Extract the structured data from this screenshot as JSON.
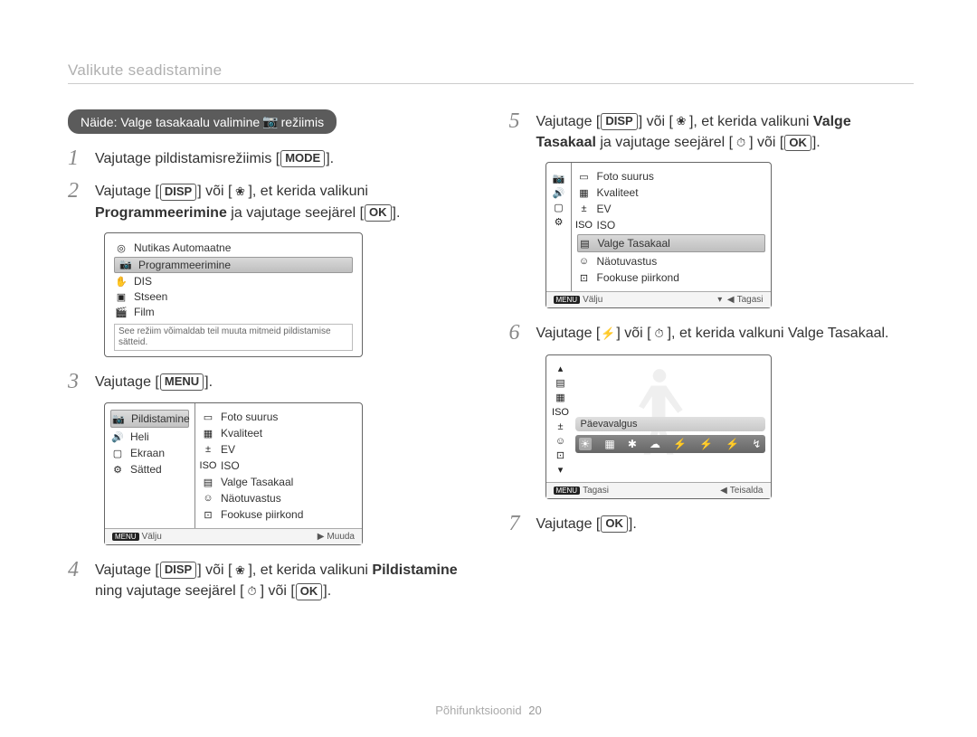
{
  "section_title": "Valikute seadistamine",
  "example_pill_prefix": "Näide: Valge tasakaalu valimine",
  "example_pill_icon": "camera-icon",
  "example_pill_suffix": "režiimis",
  "buttons": {
    "mode": "MODE",
    "disp": "DISP",
    "menu": "MENU",
    "ok": "OK"
  },
  "steps": {
    "1": {
      "text_before": "Vajutage pildistamisrežiimis [",
      "btn": "MODE",
      "text_after": "]."
    },
    "2": {
      "pre": "Vajutage [",
      "btn": "DISP",
      "mid1": "] või [",
      "icon": "macro-icon",
      "mid2": "], et kerida valikuni ",
      "bold1": "Programmeerimine",
      "mid3": " ja vajutage seejärel [",
      "ok": "OK",
      "after": "]."
    },
    "3": {
      "pre": "Vajutage [",
      "btn": "MENU",
      "after": "]."
    },
    "4": {
      "pre": "Vajutage [",
      "btn": "DISP",
      "mid1": "] või [",
      "icon1": "macro-icon",
      "mid2": "], et kerida valikuni ",
      "bold": "Pildistamine",
      "mid3": " ning vajutage seejärel [",
      "icon2": "timer-icon",
      "mid4": "] või [",
      "ok": "OK",
      "after": "]."
    },
    "5": {
      "pre": "Vajutage [",
      "btn": "DISP",
      "mid1": "] või [",
      "icon1": "macro-icon",
      "mid2": "], et kerida valikuni ",
      "bold1": "Valge Tasakaal",
      "mid3": " ja vajutage seejärel [",
      "icon2": "timer-icon",
      "mid4": "] või [",
      "ok": "OK",
      "after": "]."
    },
    "6": {
      "pre": "Vajutage [",
      "icon1": "flash-icon",
      "mid1": "] või [",
      "icon2": "timer-icon",
      "mid2": "], et kerida valkuni Valge Tasakaal."
    },
    "7": {
      "pre": "Vajutage [",
      "ok": "OK",
      "after": "]."
    }
  },
  "panel1": {
    "items": [
      {
        "icon": "smart-icon",
        "label": "Nutikas Automaatne"
      },
      {
        "icon": "camera-icon",
        "label": "Programmeerimine",
        "selected": true
      },
      {
        "icon": "dis-icon",
        "label": "DIS"
      },
      {
        "icon": "scene-icon",
        "label": "Stseen"
      },
      {
        "icon": "movie-icon",
        "label": "Film"
      }
    ],
    "hint": "See režiim võimaldab teil muuta mitmeid pildistamise sätteid."
  },
  "panel2": {
    "left": [
      {
        "icon": "camera-icon",
        "label": "Pildistamine",
        "selected": true
      },
      {
        "icon": "sound-icon",
        "label": "Heli"
      },
      {
        "icon": "display-icon",
        "label": "Ekraan"
      },
      {
        "icon": "gear-icon",
        "label": "Sätted"
      }
    ],
    "right": [
      {
        "icon": "size-icon",
        "label": "Foto suurus"
      },
      {
        "icon": "quality-icon",
        "label": "Kvaliteet"
      },
      {
        "icon": "ev-icon",
        "label": "EV"
      },
      {
        "icon": "iso-icon",
        "label": "ISO"
      },
      {
        "icon": "wb-icon",
        "label": "Valge Tasakaal"
      },
      {
        "icon": "face-icon",
        "label": "Näotuvastus"
      },
      {
        "icon": "focus-icon",
        "label": "Fookuse piirkond"
      }
    ],
    "footer_left_tag": "MENU",
    "footer_left": "Välju",
    "footer_right_arrow": "▶",
    "footer_right": "Muuda"
  },
  "panel2b": {
    "left_icon_strip": [
      "camera-icon",
      "sound-icon",
      "display-icon",
      "gear-icon"
    ],
    "right": [
      {
        "icon": "size-icon",
        "label": "Foto suurus"
      },
      {
        "icon": "quality-icon",
        "label": "Kvaliteet"
      },
      {
        "icon": "ev-icon",
        "label": "EV"
      },
      {
        "icon": "iso-icon",
        "label": "ISO"
      },
      {
        "icon": "wb-icon",
        "label": "Valge Tasakaal",
        "selected": true
      },
      {
        "icon": "face-icon",
        "label": "Näotuvastus"
      },
      {
        "icon": "focus-icon",
        "label": "Fookuse piirkond"
      }
    ],
    "footer_left_tag": "MENU",
    "footer_left": "Välju",
    "footer_right_arrow": "◀",
    "footer_right": "Tagasi"
  },
  "panel3": {
    "left_icons": [
      "up-icon",
      "wb-icon",
      "quality-icon",
      "iso-icon",
      "ev-icon",
      "face-icon",
      "focus-icon",
      "down-icon"
    ],
    "selected_label": "Päevavalgus",
    "wb_icons": [
      "☀",
      "▦",
      "✱",
      "☁",
      "⚡",
      "⚡",
      "⚡",
      "↯"
    ],
    "footer_left_tag": "MENU",
    "footer_left": "Tagasi",
    "footer_right_arrow": "◀",
    "footer_right": "Teisalda"
  },
  "footer": {
    "label": "Põhifunktsioonid",
    "page": "20"
  }
}
